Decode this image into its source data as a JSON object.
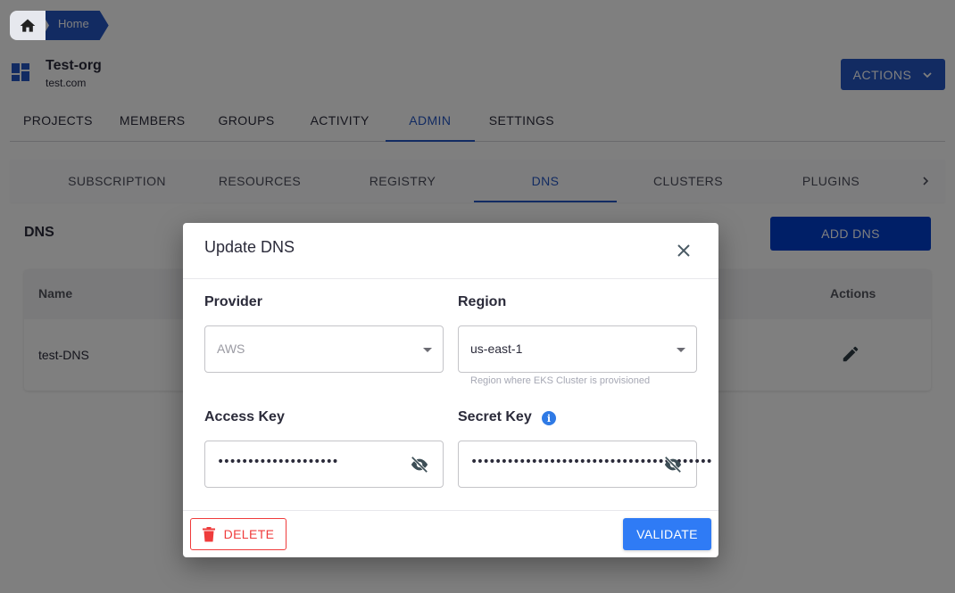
{
  "breadcrumb": {
    "home_icon": "home-icon",
    "items": [
      {
        "label": "Home"
      }
    ]
  },
  "org": {
    "icon": "dashboard-icon",
    "name": "Test-org",
    "domain": "test.com"
  },
  "header": {
    "actions_label": "ACTIONS",
    "actions_icon": "chevron-down-icon"
  },
  "main_tabs": [
    {
      "label": "PROJECTS",
      "active": false
    },
    {
      "label": "MEMBERS",
      "active": false
    },
    {
      "label": "GROUPS",
      "active": false
    },
    {
      "label": "ACTIVITY",
      "active": false
    },
    {
      "label": "ADMIN",
      "active": true
    },
    {
      "label": "SETTINGS",
      "active": false
    }
  ],
  "sub_tabs": [
    {
      "label": "SUBSCRIPTION",
      "active": false
    },
    {
      "label": "RESOURCES",
      "active": false
    },
    {
      "label": "REGISTRY",
      "active": false
    },
    {
      "label": "DNS",
      "active": true
    },
    {
      "label": "CLUSTERS",
      "active": false
    },
    {
      "label": "PLUGINS",
      "active": false
    }
  ],
  "section": {
    "title": "DNS",
    "add_button_label": "ADD DNS"
  },
  "table": {
    "columns": [
      "Name",
      "Actions"
    ],
    "rows": [
      {
        "name": "test-DNS",
        "action_icon": "edit-pencil-icon"
      }
    ]
  },
  "dialog": {
    "title": "Update DNS",
    "close_icon": "close-icon",
    "provider": {
      "label": "Provider",
      "value": "AWS",
      "disabled": true
    },
    "region": {
      "label": "Region",
      "value": "us-east-1",
      "helper": "Region where EKS Cluster is provisioned"
    },
    "access_key": {
      "label": "Access Key",
      "masked_value": "••••••••••••••••••••",
      "visibility_icon": "eye-off-icon"
    },
    "secret_key": {
      "label": "Secret Key",
      "info_icon": "info-icon",
      "masked_value": "••••••••••••••••••••••••••••••••••••••••",
      "visibility_icon": "eye-off-icon"
    },
    "delete_label": "DELETE",
    "validate_label": "VALIDATE"
  },
  "colors": {
    "primary": "#2556c4",
    "add_button": "#003fcf",
    "validate_button": "#2f7bf5",
    "danger": "#ef3b3b",
    "info": "#2f7ae5"
  }
}
